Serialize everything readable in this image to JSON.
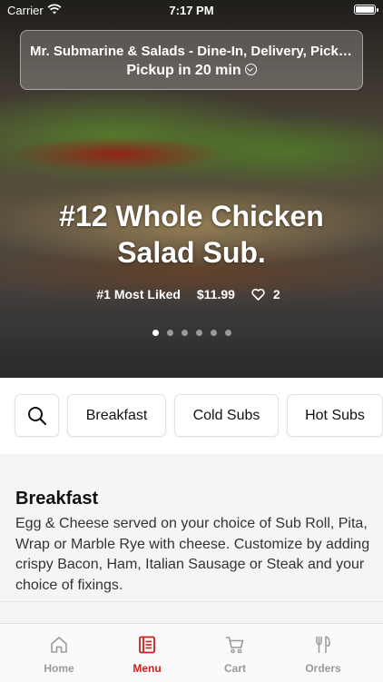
{
  "status_bar": {
    "carrier": "Carrier",
    "time": "7:17 PM"
  },
  "location": {
    "name": "Mr. Submarine & Salads - Dine-In, Delivery, Pick-...",
    "pickup": "Pickup in 20 min"
  },
  "hero": {
    "title": "#12  Whole Chicken Salad Sub.",
    "rank": "#1 Most Liked",
    "price": "$11.99",
    "likes": "2",
    "carousel_total": 6,
    "carousel_active_index": 0
  },
  "categories": [
    "Breakfast",
    "Cold Subs",
    "Hot Subs"
  ],
  "section": {
    "title": "Breakfast",
    "description": "Egg & Cheese served on your choice of Sub Roll, Pita, Wrap or Marble Rye with cheese. Customize by adding crispy Bacon, Ham, Italian Sausage or Steak and your choice of fixings."
  },
  "tabs": [
    {
      "label": "Home",
      "icon": "home-icon"
    },
    {
      "label": "Menu",
      "icon": "menu-icon",
      "active": true
    },
    {
      "label": "Cart",
      "icon": "cart-icon"
    },
    {
      "label": "Orders",
      "icon": "orders-icon"
    }
  ],
  "colors": {
    "accent": "#cc1f1f",
    "inactive_tab": "#9a9a9a"
  }
}
